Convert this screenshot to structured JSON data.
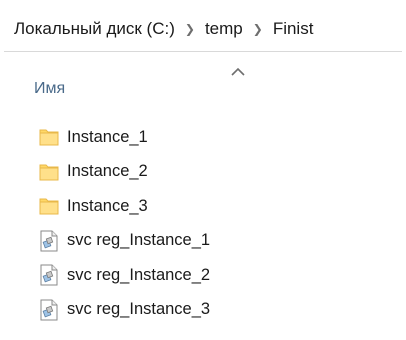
{
  "breadcrumb": [
    {
      "label": "Локальный диск (C:)"
    },
    {
      "label": "temp"
    },
    {
      "label": "Finist"
    }
  ],
  "column_header": {
    "name_label": "Имя",
    "sort_indicator": "sort-ascending-caret-icon"
  },
  "files": [
    {
      "label": "Instance_1",
      "icon": "folder-icon"
    },
    {
      "label": "Instance_2",
      "icon": "folder-icon"
    },
    {
      "label": "Instance_3",
      "icon": "folder-icon"
    },
    {
      "label": "svc reg_Instance_1",
      "icon": "registry-file-icon"
    },
    {
      "label": "svc reg_Instance_2",
      "icon": "registry-file-icon"
    },
    {
      "label": "svc reg_Instance_3",
      "icon": "registry-file-icon"
    }
  ],
  "colors": {
    "folder_fill": "#FFD867",
    "folder_edge": "#E8B84A",
    "column_header_text": "#4A6A8A",
    "separator": "#D9D9D9"
  }
}
